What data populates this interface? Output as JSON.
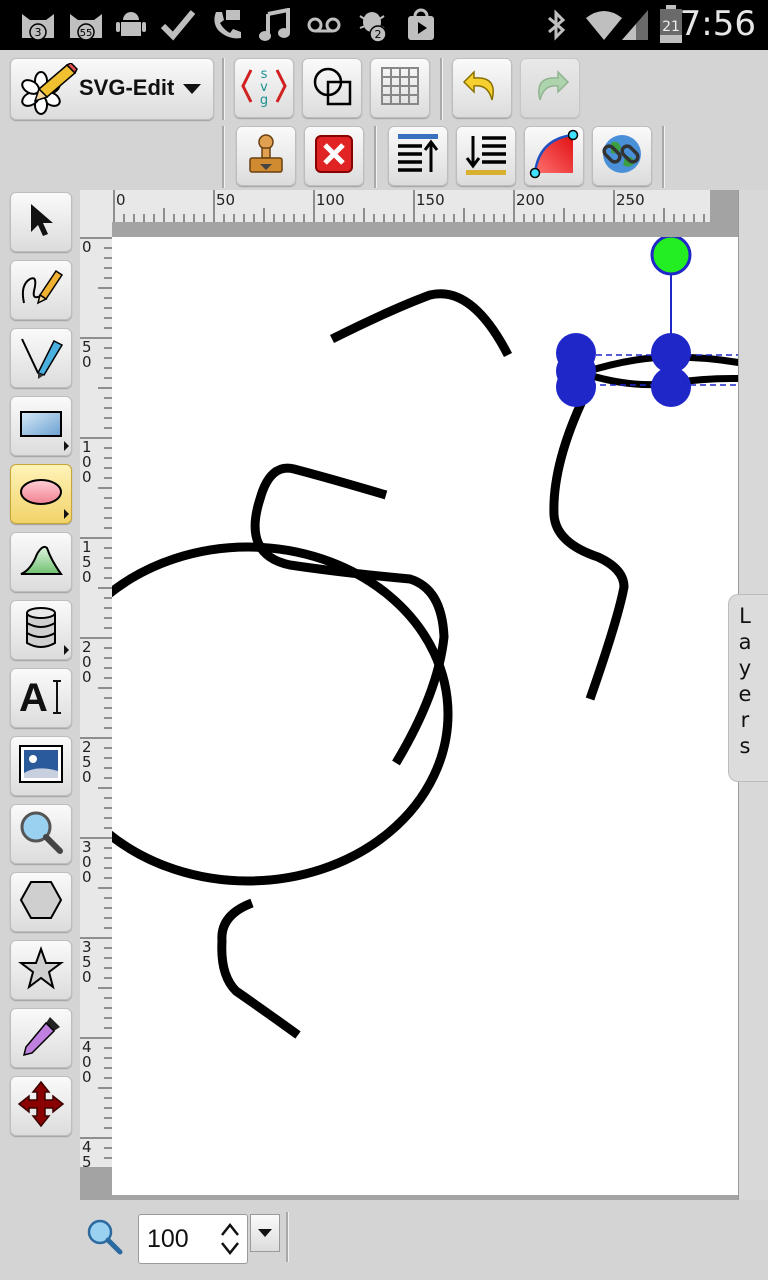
{
  "status_bar": {
    "time": "7:56",
    "notif_badges": [
      "3",
      "55",
      "2"
    ],
    "battery_level": "21",
    "icons": [
      "cat-notification-icon",
      "cat-notification-icon",
      "android-icon",
      "checkmark-icon",
      "sip-call-icon",
      "music-icon",
      "voicemail-icon",
      "bug-notification-icon",
      "play-store-icon",
      "bluetooth-icon",
      "wifi-icon",
      "signal-icon",
      "battery-icon"
    ]
  },
  "app": {
    "name": "SVG-Edit",
    "accent": "#f2d36a"
  },
  "toolbar": {
    "row1": [
      "svg-source-icon",
      "wireframe-icon",
      "grid-icon",
      "undo-icon",
      "redo-icon"
    ],
    "row2": [
      "import-icon",
      "delete-icon",
      "move-to-top-icon",
      "move-to-bottom-icon",
      "convert-to-path-icon",
      "link-icon"
    ]
  },
  "left_tools": [
    "select-tool-icon",
    "pencil-tool-icon",
    "pen-tool-icon",
    "rectangle-tool-icon",
    "ellipse-tool-icon",
    "path-tool-icon",
    "shape-library-icon",
    "text-tool-icon",
    "image-tool-icon",
    "zoom-tool-icon",
    "polygon-tool-icon",
    "star-tool-icon",
    "eyedropper-tool-icon",
    "pan-tool-icon"
  ],
  "ruler": {
    "h_labels": [
      "0",
      "50",
      "100",
      "150",
      "200",
      "250"
    ],
    "v_labels": [
      "0",
      "50",
      "100",
      "150",
      "200",
      "250",
      "300",
      "350",
      "400",
      "45"
    ]
  },
  "layers_label": "Layers",
  "zoom": {
    "value": "100"
  },
  "colors": {
    "handle_blue": "#1f27c8",
    "rotate_handle": "#22ee22"
  }
}
